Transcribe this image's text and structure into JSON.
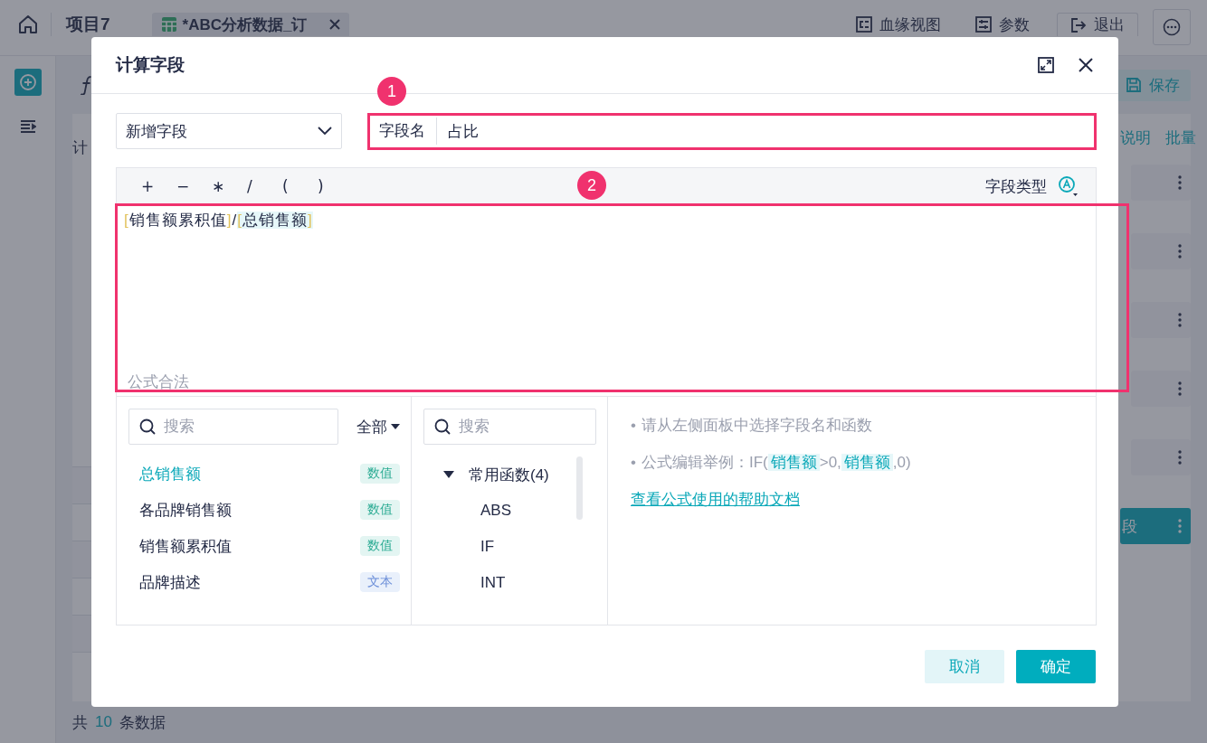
{
  "app_bar": {
    "project": "项目7",
    "tab": {
      "label": "*ABC分析数据_订",
      "selected": true
    },
    "actions": [
      {
        "kind": "lineage",
        "label": "血缘视图"
      },
      {
        "kind": "params",
        "label": "参数"
      },
      {
        "kind": "exit",
        "label": "退出"
      }
    ]
  },
  "workspace": {
    "section_label": "计",
    "save_button": "保存",
    "links": [
      "说明",
      "批量"
    ],
    "cards": [
      {
        "kind": "plain"
      },
      {
        "kind": "plain"
      },
      {
        "kind": "plain"
      },
      {
        "kind": "plain"
      },
      {
        "kind": "plain"
      },
      {
        "kind": "active",
        "label": "段"
      }
    ],
    "footer": {
      "prefix": "共",
      "count": "10",
      "suffix": "条数据"
    }
  },
  "dialog": {
    "title": "计算字段",
    "mode_select": {
      "value": "新增字段"
    },
    "field_name": {
      "label": "字段名",
      "value": "占比"
    },
    "operators": [
      "+",
      "−",
      "∗",
      "/",
      "(",
      ")"
    ],
    "field_type_label": "字段类型",
    "formula": [
      {
        "kind": "field",
        "open": "[",
        "text": "销售额累积值",
        "close": "]",
        "highlighted": false
      },
      {
        "kind": "operator",
        "text": "/"
      },
      {
        "kind": "field",
        "open": "[",
        "text": "总销售额",
        "close": "]",
        "highlighted": true
      }
    ],
    "status": "公式合法",
    "fields_panel": {
      "search": {
        "placeholder": "搜索"
      },
      "filter": "全部",
      "items": [
        {
          "name": "总销售额",
          "type": "数值",
          "kind": "number",
          "selected": true
        },
        {
          "name": "各品牌销售额",
          "type": "数值",
          "kind": "number",
          "selected": false
        },
        {
          "name": "销售额累积值",
          "type": "数值",
          "kind": "number",
          "selected": false
        },
        {
          "name": "品牌描述",
          "type": "文本",
          "kind": "text",
          "selected": false
        }
      ]
    },
    "functions_panel": {
      "search": {
        "placeholder": "搜索"
      },
      "groups": [
        {
          "label": "常用函数(4)",
          "expanded": true,
          "children": [
            {
              "label": "ABS"
            },
            {
              "label": "IF"
            },
            {
              "label": "INT"
            }
          ]
        }
      ]
    },
    "help": {
      "tips": [
        {
          "bullet": "•",
          "parts": [
            {
              "kind": "plain",
              "text": "请从左侧面板中选择字段名和函数"
            }
          ]
        },
        {
          "bullet": "•",
          "parts": [
            {
              "kind": "plain",
              "text": "公式编辑举例：IF("
            },
            {
              "kind": "field",
              "text": "销售额"
            },
            {
              "kind": "plain",
              "text": ">0,"
            },
            {
              "kind": "field",
              "text": "销售额"
            },
            {
              "kind": "plain",
              "text": ",0)"
            }
          ]
        }
      ],
      "link": "查看公式使用的帮助文档"
    },
    "buttons": [
      {
        "kind": "secondary",
        "label": "取消"
      },
      {
        "kind": "primary",
        "label": "确定"
      }
    ]
  },
  "annotations": [
    {
      "number": "1"
    },
    {
      "number": "2"
    }
  ]
}
